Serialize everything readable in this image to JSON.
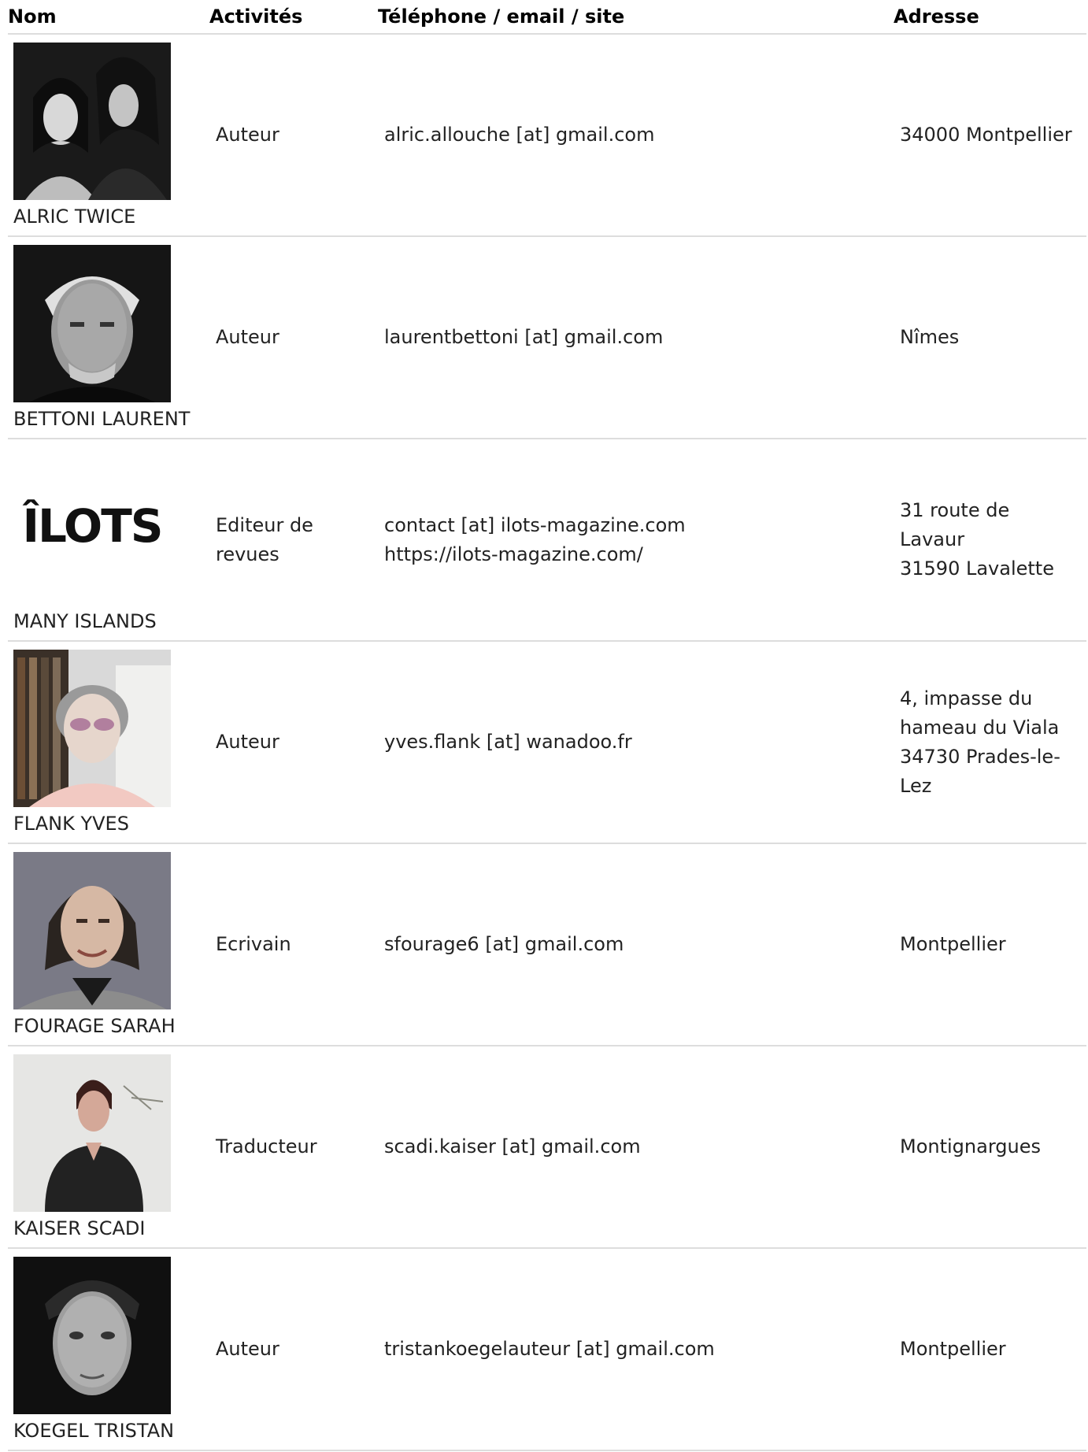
{
  "headers": {
    "nom": "Nom",
    "activites": "Activités",
    "contact": "Téléphone / email / site",
    "adresse": "Adresse"
  },
  "rows": [
    {
      "name": "ALRIC TWICE",
      "activity": [
        "Auteur"
      ],
      "contact": [
        "alric.allouche [at] gmail.com"
      ],
      "address": [
        "34000 Montpellier"
      ],
      "photo": "duo-portrait-photo"
    },
    {
      "name": "BETTONI LAURENT",
      "activity": [
        "Auteur"
      ],
      "contact": [
        "laurentbettoni [at] gmail.com"
      ],
      "address": [
        "Nîmes"
      ],
      "photo": "man-portrait-photo"
    },
    {
      "name": "MANY ISLANDS",
      "activity": [
        "Editeur de",
        "revues"
      ],
      "contact": [
        "contact [at] ilots-magazine.com",
        "https://ilots-magazine.com/"
      ],
      "address": [
        "31 route de",
        "Lavaur",
        "31590 Lavalette"
      ],
      "logo": "ÎLOTS"
    },
    {
      "name": "FLANK YVES",
      "activity": [
        "Auteur"
      ],
      "contact": [
        "yves.flank [at] wanadoo.fr"
      ],
      "address": [
        "4, impasse du",
        "hameau du Viala",
        "34730 Prades-le-",
        "Lez"
      ],
      "photo": "webcam-portrait-photo"
    },
    {
      "name": "FOURAGE SARAH",
      "activity": [
        "Ecrivain"
      ],
      "contact": [
        "sfourage6 [at] gmail.com"
      ],
      "address": [
        "Montpellier"
      ],
      "photo": "woman-portrait-photo"
    },
    {
      "name": "KAISER SCADI",
      "activity": [
        "Traducteur"
      ],
      "contact": [
        "scadi.kaiser [at] gmail.com"
      ],
      "address": [
        "Montignargues"
      ],
      "photo": "woman-standing-photo"
    },
    {
      "name": "KOEGEL TRISTAN",
      "activity": [
        "Auteur"
      ],
      "contact": [
        "tristankoegelauteur [at] gmail.com"
      ],
      "address": [
        "Montpellier"
      ],
      "photo": "man-closeup-photo"
    }
  ],
  "colors": {
    "rule": "#dddddd",
    "text": "#222222",
    "header_text": "#000000"
  }
}
